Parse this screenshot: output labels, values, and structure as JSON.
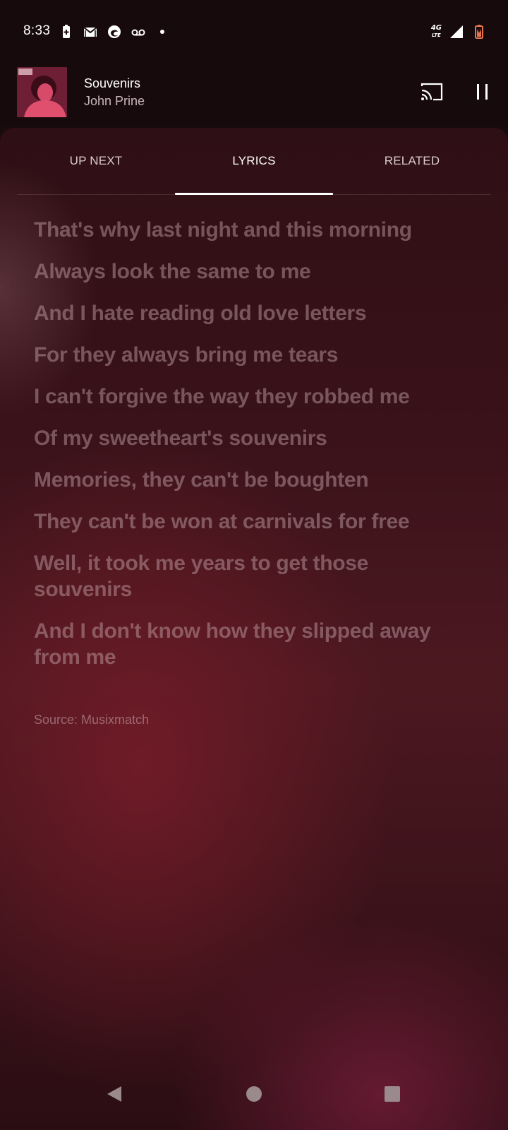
{
  "status_bar": {
    "time": "8:33",
    "left_icons": [
      "battery-saver-icon",
      "gmail-icon",
      "edge-browser-icon",
      "voicemail-icon",
      "notification-dot-icon"
    ],
    "network_label": "4G",
    "network_sub": "LTE",
    "right_icons": [
      "signal-icon",
      "battery-charging-icon"
    ],
    "battery_color": "#e8734a"
  },
  "now_playing": {
    "title": "Souvenirs",
    "artist": "John Prine"
  },
  "tabs": [
    {
      "label": "UP NEXT",
      "active": false
    },
    {
      "label": "LYRICS",
      "active": true
    },
    {
      "label": "RELATED",
      "active": false
    }
  ],
  "lyrics": [
    "That's why last night and this morning",
    "Always look the same to me",
    "And I hate reading old love letters",
    "For they always bring me tears",
    "I can't forgive the way they robbed me",
    "Of my sweetheart's souvenirs",
    "Memories, they can't be boughten",
    "They can't be won at carnivals for free",
    "Well, it took me years to get those souvenirs",
    "And I don't know how they slipped away from me"
  ],
  "source": "Source: Musixmatch",
  "nav": [
    "back-icon",
    "home-icon",
    "recents-icon"
  ]
}
